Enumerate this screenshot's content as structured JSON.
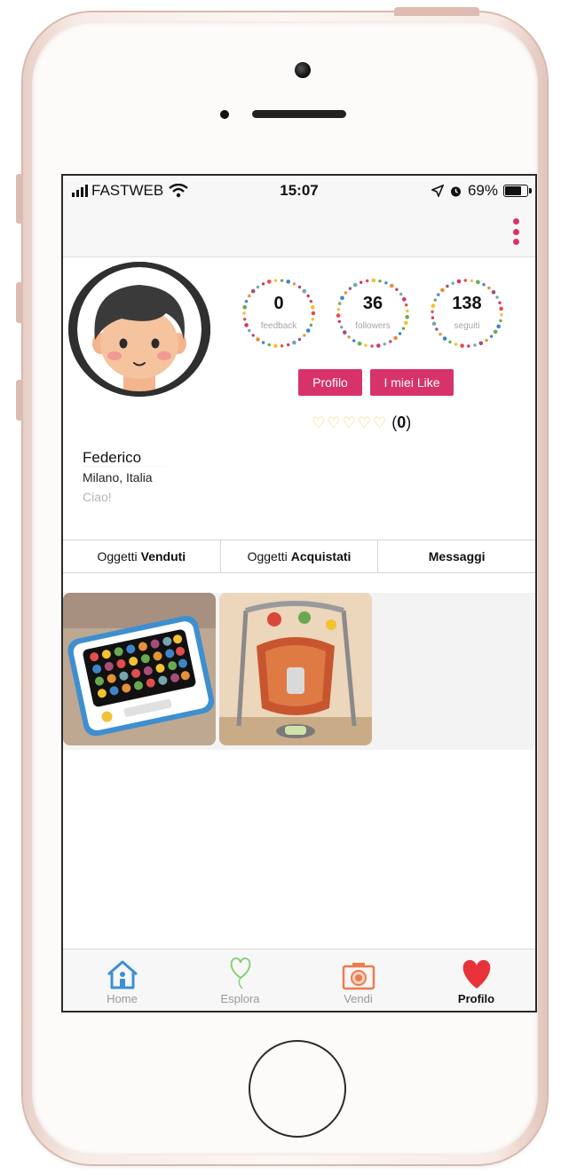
{
  "status_bar": {
    "carrier": "FASTWEB",
    "time": "15:07",
    "battery": "69%"
  },
  "profile": {
    "name": "Federico",
    "location": "Milano, Italia",
    "bio": "Ciao!"
  },
  "stats": [
    {
      "value": "0",
      "label": "feedback"
    },
    {
      "value": "36",
      "label": "followers"
    },
    {
      "value": "138",
      "label": "seguiti"
    }
  ],
  "buttons": {
    "profile": "Profilo",
    "likes": "I miei Like"
  },
  "rating": {
    "count": "0",
    "hearts_filled": 0,
    "hearts_total": 5
  },
  "tabs": [
    {
      "prefix": "Oggetti",
      "bold": "Venduti"
    },
    {
      "prefix": "Oggetti",
      "bold": "Acquistati"
    },
    {
      "prefix": "",
      "bold": "Messaggi"
    }
  ],
  "items": [
    {
      "icon": "toy-tablet-photo"
    },
    {
      "icon": "baby-swing-photo"
    }
  ],
  "tab_bar": [
    {
      "label": "Home",
      "icon": "home-icon",
      "active": false
    },
    {
      "label": "Esplora",
      "icon": "heart-balloon-icon",
      "active": false
    },
    {
      "label": "Vendi",
      "icon": "camera-icon",
      "active": false
    },
    {
      "label": "Profilo",
      "icon": "heart-icon",
      "active": true
    }
  ],
  "colors": {
    "accent": "#d8326b",
    "rating_heart": "#f0d66a",
    "profile_heart": "#e8323a",
    "home_blue": "#3b8fd6",
    "explore_green": "#7fcf6a",
    "camera_orange": "#f07a4a"
  }
}
